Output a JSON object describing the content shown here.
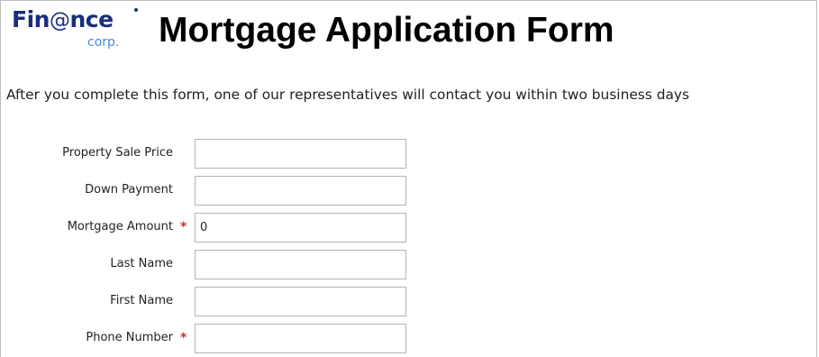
{
  "logo": {
    "main_prefix": "Fin",
    "main_at": "@",
    "main_suffix": "nce",
    "sub": "corp."
  },
  "page": {
    "title": "Mortgage Application Form",
    "intro": "After you complete this form, one of our representatives will contact you within two business days"
  },
  "form": {
    "fields": [
      {
        "label": "Property Sale Price",
        "value": "",
        "required": false
      },
      {
        "label": "Down Payment",
        "value": "",
        "required": false
      },
      {
        "label": "Mortgage Amount",
        "value": "0",
        "required": true
      },
      {
        "label": "Last Name",
        "value": "",
        "required": false
      },
      {
        "label": "First Name",
        "value": "",
        "required": false
      },
      {
        "label": "Phone Number",
        "value": "",
        "required": true
      }
    ],
    "required_marker": "*"
  },
  "colors": {
    "logo_primary": "#1a2e7a",
    "logo_secondary": "#4a89d0",
    "required_marker": "#d22b2b",
    "input_border": "#b3b3b3"
  }
}
